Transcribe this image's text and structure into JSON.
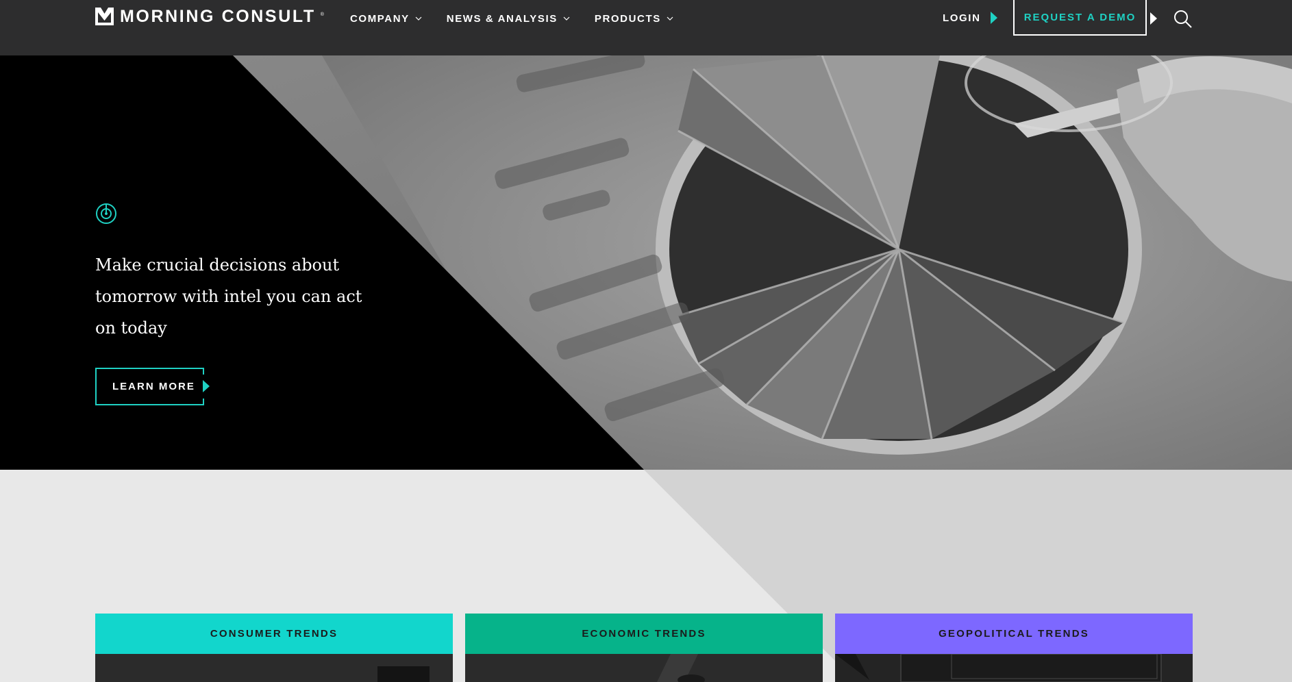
{
  "brand": {
    "name": "MORNING CONSULT",
    "reg": "®",
    "accent": "#1fd1c3",
    "header_bg": "#2d2d2e"
  },
  "nav": {
    "items": [
      {
        "label": "COMPANY",
        "icon": "chevron-down-icon"
      },
      {
        "label": "NEWS & ANALYSIS",
        "icon": "chevron-down-icon"
      },
      {
        "label": "PRODUCTS",
        "icon": "chevron-down-icon"
      }
    ],
    "login_label": "LOGIN",
    "demo_label": "REQUEST A DEMO",
    "search_icon": "search-icon"
  },
  "hero": {
    "icon": "target-icon",
    "headline": "Make crucial decisions about tomorrow with intel you can act on today",
    "cta_label": "LEARN MORE"
  },
  "cards": [
    {
      "label": "CONSUMER TRENDS",
      "color": "#12d6cc"
    },
    {
      "label": "ECONOMIC TRENDS",
      "color": "#06b38a"
    },
    {
      "label": "GEOPOLITICAL TRENDS",
      "color": "#7d68ff"
    }
  ]
}
